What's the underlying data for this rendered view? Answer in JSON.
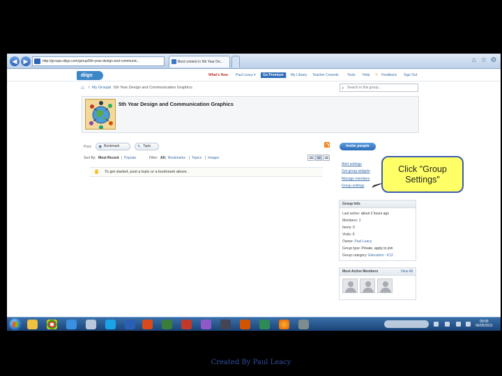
{
  "browser": {
    "address": "http://groups.diigo.com/group/5th-year-design-and-communic...",
    "active_tab": "Best content in 5th Year De...",
    "new_tab": "",
    "home_icon": "home-icon",
    "star_icon": "star-icon",
    "gear_icon": "gear-icon"
  },
  "site": {
    "logo": "diigo",
    "nav": {
      "whats_new": "What's New",
      "user": "Paul Leacy ▾",
      "go_premium": "Go Premium",
      "my_library": "My Library",
      "teacher_console": "Teacher Console",
      "tools": "Tools",
      "help": "Help",
      "feedback": "Feedback",
      "sign_out": "Sign Out"
    }
  },
  "breadcrumb": {
    "my_groups": "My Groups",
    "separator": "/",
    "group": "5th Year Design and Communication Graphics"
  },
  "search": {
    "placeholder": "Search in this group..."
  },
  "group": {
    "title": "5th Year Design and Communication Graphics"
  },
  "post_bar": {
    "label": "Post:",
    "bookmark": "Bookmark",
    "topic": "Topic"
  },
  "filters": {
    "sort_label": "Sort By:",
    "most_recent": "Most Recent",
    "popular": "Popular",
    "filter_label": "Filter:",
    "all": "All",
    "bookmarks": "Bookmarks",
    "topics": "Topics",
    "images": "Images",
    "pipe": "|"
  },
  "empty_message": "To get started, post a topic or a bookmark above.",
  "sidebar": {
    "invite": "Invite people",
    "links": [
      "Alert settings",
      "Get group widgets",
      "Manage members",
      "Group settings"
    ],
    "group_info": {
      "title": "Group Info",
      "rows": [
        {
          "label": "Last active:",
          "value": "about 2 hours ago"
        },
        {
          "label": "Members:",
          "value": "3"
        },
        {
          "label": "Items:",
          "value": "0"
        },
        {
          "label": "Visits:",
          "value": "0"
        },
        {
          "label": "Owner:",
          "value": "Paul Leacy"
        },
        {
          "label": "Group type:",
          "value": "Private, apply to join"
        },
        {
          "label": "Group category:",
          "value": "Education - K12"
        }
      ]
    },
    "active_members": {
      "title": "Most Active Members",
      "view_all": "View All"
    }
  },
  "callout": {
    "line1": "Click \"Group",
    "line2": "Settings\""
  },
  "taskbar": {
    "clock_time": "09:09",
    "clock_date": "06/05/2011"
  },
  "footer": "Created By Paul Leacy",
  "colors": {
    "accent": "#2d6cb8",
    "callout_fill": "#ffff66",
    "callout_border": "#3b5bb0"
  }
}
